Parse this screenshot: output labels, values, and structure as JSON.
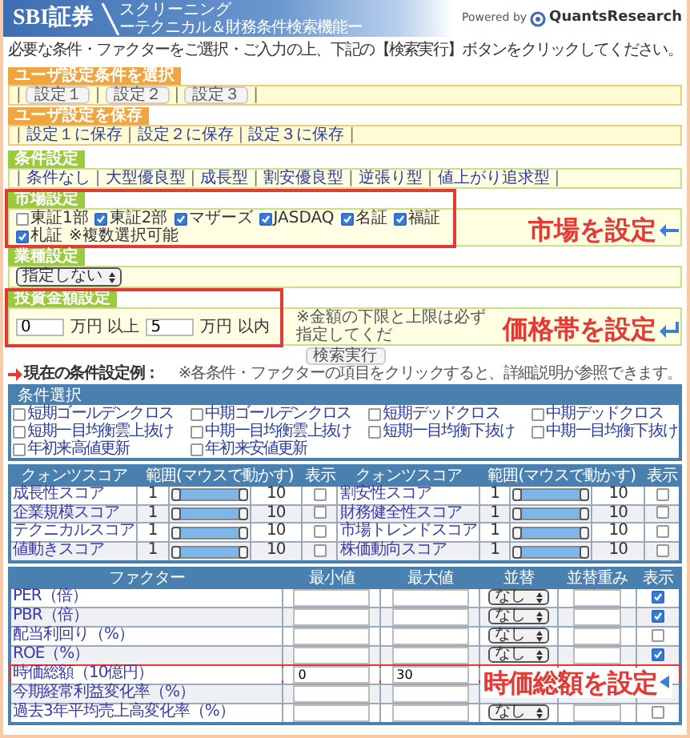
{
  "header": {
    "brand": "SBI証券",
    "title": "スクリーニング",
    "subtitle": "ーテクニカル＆財務条件検索機能ー",
    "powered_by": "Powered by",
    "partner": "QuantsResearch"
  },
  "instruction": "必要な条件・ファクターをご選択・ご入力の上、下記の【検索実行】ボタンをクリックしてください。",
  "user_select": {
    "tab": "ユーザ設定条件を選択",
    "separator": "|",
    "buttons": [
      "設定１",
      "設定２",
      "設定３"
    ]
  },
  "user_save": {
    "tab": "ユーザ設定を保存",
    "separator": "|",
    "links": [
      "設定１に保存",
      "設定２に保存",
      "設定３に保存"
    ]
  },
  "presets": {
    "tab": "条件設定",
    "separator": "|",
    "links": [
      "条件なし",
      "大型優良型",
      "成長型",
      "割安優良型",
      "逆張り型",
      "値上がり追求型"
    ]
  },
  "market": {
    "tab": "市場設定",
    "highlighted": true,
    "annotation": "市場を設定",
    "note": "※複数選択可能",
    "options": [
      {
        "label": "東証1部",
        "checked": false
      },
      {
        "label": "東証2部",
        "checked": true
      },
      {
        "label": "マザーズ",
        "checked": true
      },
      {
        "label": "JASDAQ",
        "checked": true
      },
      {
        "label": "名証",
        "checked": true
      },
      {
        "label": "福証",
        "checked": true
      },
      {
        "label": "札証",
        "checked": true
      }
    ]
  },
  "industry": {
    "tab": "業種設定",
    "select": "指定しない"
  },
  "investment": {
    "tab": "投資金額設定",
    "highlighted": true,
    "annotation": "価格帯を設定",
    "min": "0",
    "min_unit": "万円 以上",
    "max": "5",
    "max_unit": "万円 以内",
    "note": "※金額の下限と上限は必ず指定してくだ"
  },
  "search_button": "検索実行",
  "current": {
    "title": "現在の条件設定例：",
    "note": "※各条件・ファクターの項目をクリックすると、詳細説明が参照できます。"
  },
  "conditions": {
    "title": "条件選択",
    "items": [
      {
        "label": "短期ゴールデンクロス",
        "checked": false
      },
      {
        "label": "中期ゴールデンクロス",
        "checked": false
      },
      {
        "label": "短期デッドクロス",
        "checked": false
      },
      {
        "label": "中期デッドクロス",
        "checked": false
      },
      {
        "label": "短期一目均衡雲上抜け",
        "checked": false
      },
      {
        "label": "中期一目均衡雲上抜け",
        "checked": false
      },
      {
        "label": "短期一目均衡下抜け",
        "checked": false
      },
      {
        "label": "中期一目均衡下抜け",
        "checked": false
      },
      {
        "label": "年初来高値更新",
        "checked": false
      },
      {
        "label": "年初来安値更新",
        "checked": false
      }
    ]
  },
  "scores": {
    "columns": [
      "クォンツスコア",
      "範囲(マウスで動かす)",
      "表示",
      "クォンツスコア",
      "範囲(マウスで動かす)",
      "表示"
    ],
    "rows": [
      {
        "left": {
          "name": "成長性スコア",
          "min": "1",
          "max": "10",
          "level": 1,
          "shown": false
        },
        "right": {
          "name": "割安性スコア",
          "min": "1",
          "max": "10",
          "level": 1,
          "shown": false
        }
      },
      {
        "left": {
          "name": "企業規模スコア",
          "min": "1",
          "max": "10",
          "level": 1,
          "shown": false
        },
        "right": {
          "name": "財務健全性スコア",
          "min": "1",
          "max": "10",
          "level": 1,
          "shown": false
        }
      },
      {
        "left": {
          "name": "テクニカルスコア",
          "min": "1",
          "max": "10",
          "level": 1,
          "shown": false
        },
        "right": {
          "name": "市場トレンドスコア",
          "min": "1",
          "max": "10",
          "level": 1,
          "shown": false
        }
      },
      {
        "left": {
          "name": "値動きスコア",
          "min": "1",
          "max": "10",
          "level": 1,
          "shown": false
        },
        "right": {
          "name": "株価動向スコア",
          "min": "1",
          "max": "10",
          "level": 1,
          "shown": false
        }
      }
    ]
  },
  "factors": {
    "columns": [
      "ファクター",
      "最小値",
      "最大値",
      "並替",
      "並替重み",
      "表示"
    ],
    "annotation": "時価総額を設定",
    "rows": [
      {
        "name": "PER（倍）",
        "sort": "なし",
        "shown": true
      },
      {
        "name": "PBR（倍）",
        "sort": "なし",
        "shown": true
      },
      {
        "name": "配当利回り（%）",
        "sort": "なし",
        "shown": false
      },
      {
        "name": "ROE（%）",
        "sort": "なし",
        "shown": true
      },
      {
        "name": "時価総額（10億円）",
        "min": "0",
        "max": "30",
        "highlighted": true
      },
      {
        "name": "今期経常利益変化率（%）"
      },
      {
        "name": "過去3年平均売上高変化率（%）",
        "sort": "なし",
        "shown": false
      }
    ]
  }
}
